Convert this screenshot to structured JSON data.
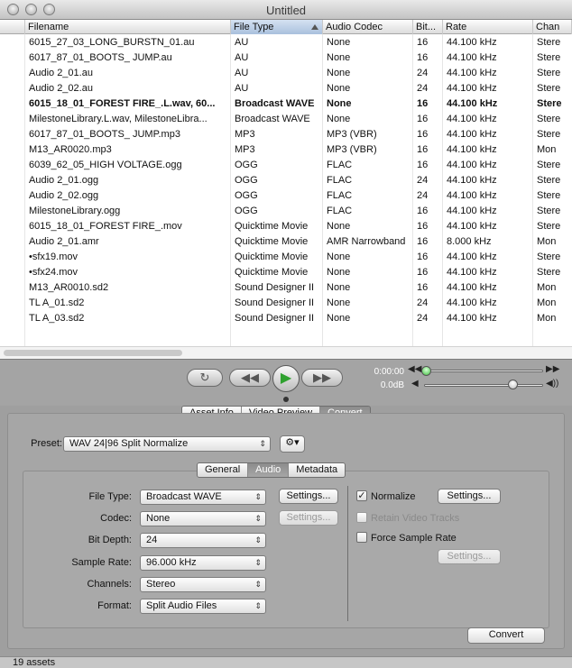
{
  "window": {
    "title": "Untitled"
  },
  "table": {
    "columns": [
      "Filename",
      "File Type",
      "Audio Codec",
      "Bit...",
      "Rate",
      "Chan"
    ],
    "rows": [
      {
        "filename": "6015_27_03_LONG_BURSTN_01.au",
        "type": "AU",
        "codec": "None",
        "bits": "16",
        "rate": "44.100 kHz",
        "chan": "Stere"
      },
      {
        "filename": "6017_87_01_BOOTS_ JUMP.au",
        "type": "AU",
        "codec": "None",
        "bits": "16",
        "rate": "44.100 kHz",
        "chan": "Stere"
      },
      {
        "filename": "Audio 2_01.au",
        "type": "AU",
        "codec": "None",
        "bits": "24",
        "rate": "44.100 kHz",
        "chan": "Stere"
      },
      {
        "filename": "Audio 2_02.au",
        "type": "AU",
        "codec": "None",
        "bits": "24",
        "rate": "44.100 kHz",
        "chan": "Stere"
      },
      {
        "filename": "6015_18_01_FOREST FIRE_.L.wav, 60...",
        "type": "Broadcast WAVE",
        "codec": "None",
        "bits": "16",
        "rate": "44.100 kHz",
        "chan": "Stere"
      },
      {
        "filename": "MilestoneLibrary.L.wav, MilestoneLibra...",
        "type": "Broadcast WAVE",
        "codec": "None",
        "bits": "16",
        "rate": "44.100 kHz",
        "chan": "Stere"
      },
      {
        "filename": "6017_87_01_BOOTS_ JUMP.mp3",
        "type": "MP3",
        "codec": "MP3 (VBR)",
        "bits": "16",
        "rate": "44.100 kHz",
        "chan": "Stere"
      },
      {
        "filename": "M13_AR0020.mp3",
        "type": "MP3",
        "codec": "MP3 (VBR)",
        "bits": "16",
        "rate": "44.100 kHz",
        "chan": "Mon"
      },
      {
        "filename": "6039_62_05_HIGH VOLTAGE.ogg",
        "type": "OGG",
        "codec": "FLAC",
        "bits": "16",
        "rate": "44.100 kHz",
        "chan": "Stere"
      },
      {
        "filename": "Audio 2_01.ogg",
        "type": "OGG",
        "codec": "FLAC",
        "bits": "24",
        "rate": "44.100 kHz",
        "chan": "Stere"
      },
      {
        "filename": "Audio 2_02.ogg",
        "type": "OGG",
        "codec": "FLAC",
        "bits": "24",
        "rate": "44.100 kHz",
        "chan": "Stere"
      },
      {
        "filename": "MilestoneLibrary.ogg",
        "type": "OGG",
        "codec": "FLAC",
        "bits": "16",
        "rate": "44.100 kHz",
        "chan": "Stere"
      },
      {
        "filename": "6015_18_01_FOREST FIRE_.mov",
        "type": "Quicktime Movie",
        "codec": "None",
        "bits": "16",
        "rate": "44.100 kHz",
        "chan": "Stere"
      },
      {
        "filename": "Audio 2_01.amr",
        "type": "Quicktime Movie",
        "codec": "AMR Narrowband",
        "bits": "16",
        "rate": "8.000 kHz",
        "chan": "Mon"
      },
      {
        "filename": "•sfx19.mov",
        "type": "Quicktime Movie",
        "codec": "None",
        "bits": "16",
        "rate": "44.100 kHz",
        "chan": "Stere"
      },
      {
        "filename": "•sfx24.mov",
        "type": "Quicktime Movie",
        "codec": "None",
        "bits": "16",
        "rate": "44.100 kHz",
        "chan": "Stere"
      },
      {
        "filename": "M13_AR0010.sd2",
        "type": "Sound Designer II",
        "codec": "None",
        "bits": "16",
        "rate": "44.100 kHz",
        "chan": "Mon"
      },
      {
        "filename": "TL A_01.sd2",
        "type": "Sound Designer II",
        "codec": "None",
        "bits": "24",
        "rate": "44.100 kHz",
        "chan": "Mon"
      },
      {
        "filename": "TL A_03.sd2",
        "type": "Sound Designer II",
        "codec": "None",
        "bits": "24",
        "rate": "44.100 kHz",
        "chan": "Mon"
      }
    ]
  },
  "transport": {
    "time": "0:00:00",
    "gain": "0.0dB",
    "loop_icon": "loop-icon",
    "rewind_icon": "rewind-icon",
    "play_icon": "play-icon",
    "ffwd_icon": "fast-forward-icon"
  },
  "main_tabs": [
    "Asset Info",
    "Video Preview",
    "Convert"
  ],
  "preset": {
    "label": "Preset:",
    "value": "WAV 24|96 Split Normalize",
    "gear_icon": "gear-icon"
  },
  "sub_tabs": [
    "General",
    "Audio",
    "Metadata"
  ],
  "audio": {
    "file_type_label": "File Type:",
    "file_type": "Broadcast WAVE",
    "codec_label": "Codec:",
    "codec": "None",
    "bit_depth_label": "Bit Depth:",
    "bit_depth": "24",
    "sample_rate_label": "Sample Rate:",
    "sample_rate": "96.000 kHz",
    "channels_label": "Channels:",
    "channels": "Stereo",
    "format_label": "Format:",
    "format": "Split Audio Files",
    "settings_label": "Settings...",
    "normalize_label": "Normalize",
    "retain_label": "Retain Video Tracks",
    "force_rate_label": "Force Sample Rate"
  },
  "convert_label": "Convert",
  "status": {
    "assets": "19 assets"
  }
}
